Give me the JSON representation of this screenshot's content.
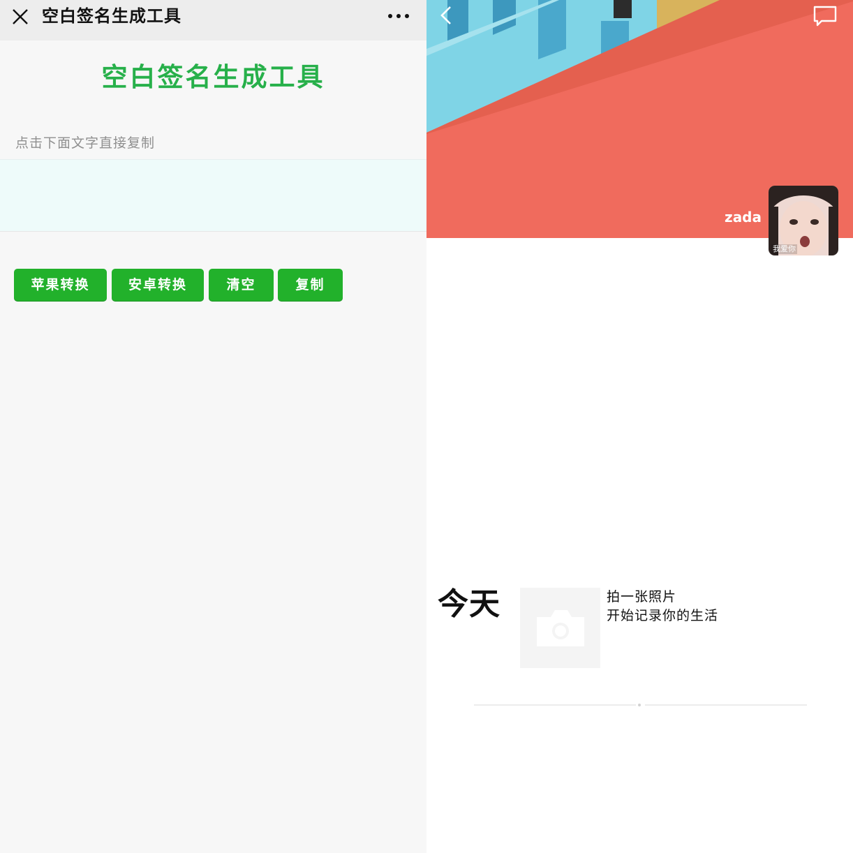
{
  "left_panel": {
    "topbar": {
      "close_icon": "close-icon",
      "title": "空白签名生成工具",
      "more_icon": "more-icon"
    },
    "heading": "空白签名生成工具",
    "hint": "点击下面文字直接复制",
    "signature_area_value": "",
    "buttons": [
      {
        "label": "苹果转换"
      },
      {
        "label": "安卓转换"
      },
      {
        "label": "清空"
      },
      {
        "label": "复制"
      }
    ]
  },
  "right_panel": {
    "back_icon": "chevron-left-icon",
    "message_icon": "message-icon",
    "username": "zada",
    "avatar_caption": "我爱你",
    "today_label": "今天",
    "camera_icon": "camera-icon",
    "prompt_line1": "拍一张照片",
    "prompt_line2": "开始记录你的生活"
  },
  "colors": {
    "accent_green": "#22b12b",
    "heading_green": "#27b04a",
    "cover_coral": "#f06b5d",
    "cover_sky": "#7fd4e6"
  }
}
